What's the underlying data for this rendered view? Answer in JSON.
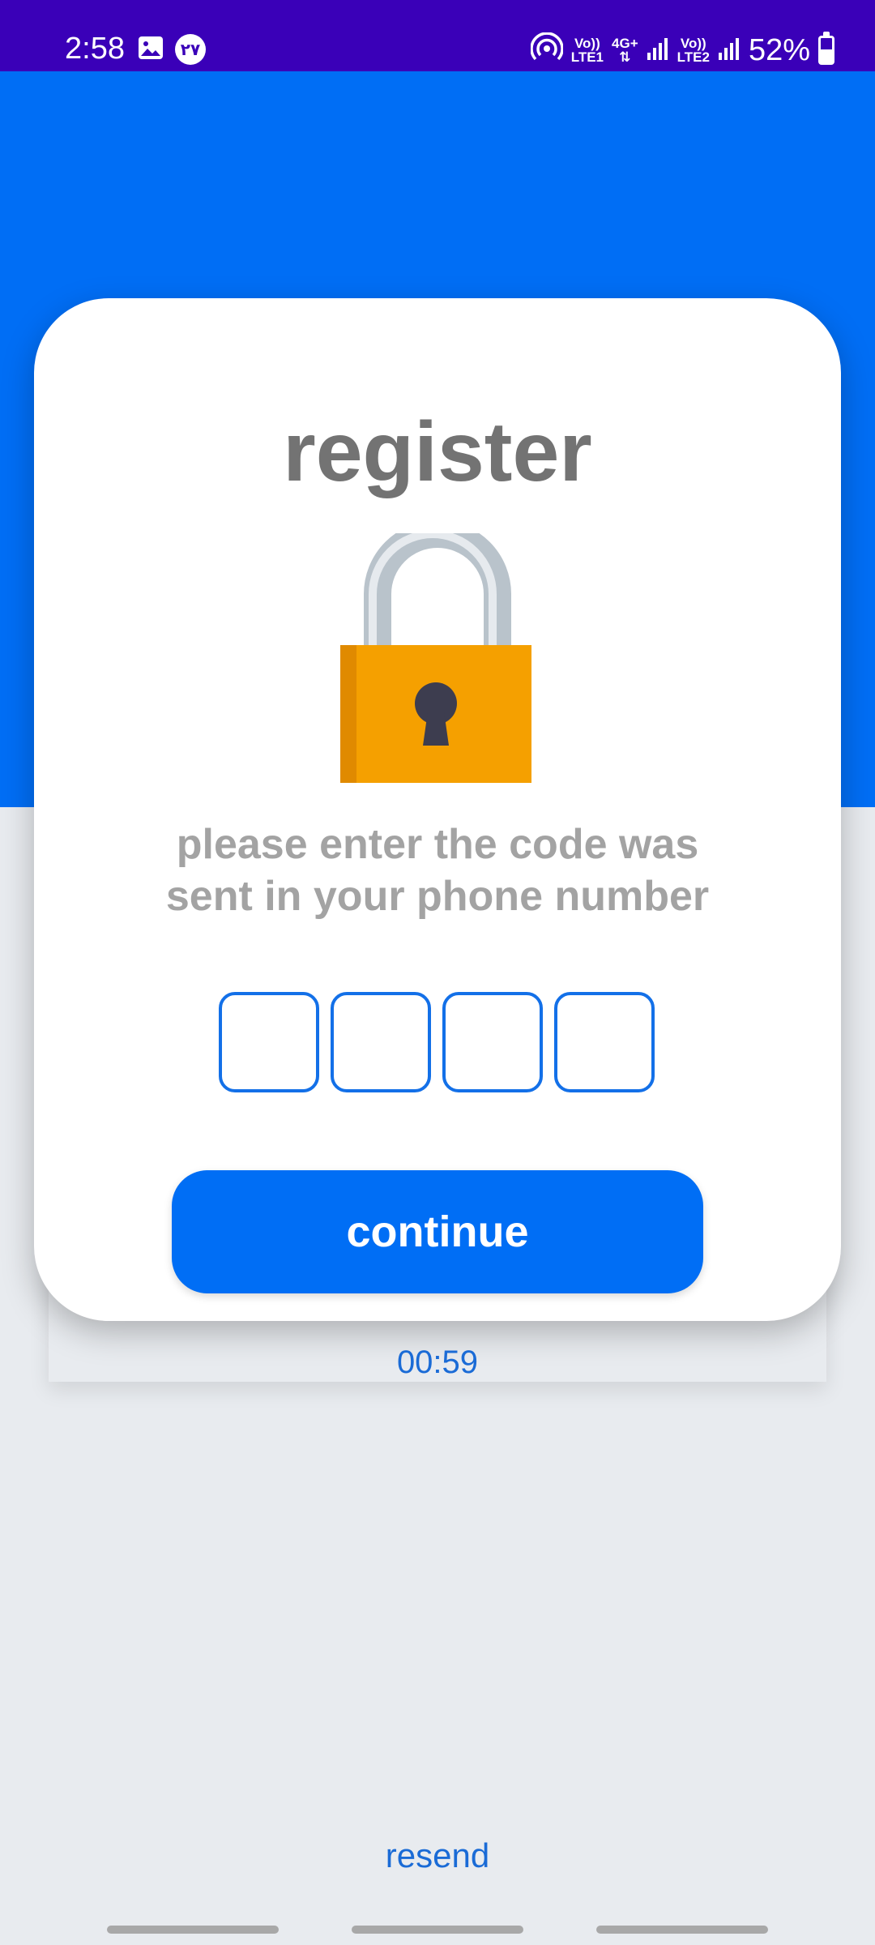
{
  "status_bar": {
    "time": "2:58",
    "badge": "٢٧",
    "sim1_top": "Vo))",
    "sim1_bottom": "LTE1",
    "net_type": "4G+",
    "sim2_top": "Vo))",
    "sim2_bottom": "LTE2",
    "battery": "52%",
    "battery_level": 0.52,
    "icons": [
      "gallery-icon",
      "hotspot-icon",
      "signal-icon",
      "battery-charging-icon"
    ]
  },
  "card": {
    "title": "register",
    "instructions": "please enter the code was sent in your phone number",
    "otp_digits": [
      "",
      "",
      "",
      ""
    ],
    "continue_label": "continue"
  },
  "timer": "00:59",
  "resend_label": "resend",
  "colors": {
    "header_blue": "#006ef5",
    "status_bar": "#3a00b8",
    "lock_body": "#f5a000",
    "lock_shackle": "#b9c3cb",
    "keyhole": "#3d3d4f",
    "link_blue": "#1a6bd6"
  }
}
